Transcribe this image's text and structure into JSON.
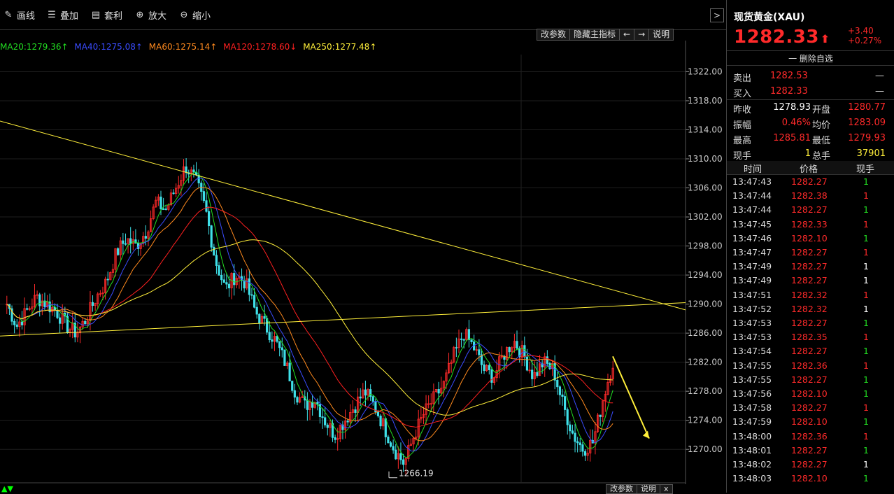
{
  "toolbar": {
    "draw": {
      "label": "画线",
      "icon": "pencil-icon"
    },
    "overlay": {
      "label": "叠加",
      "icon": "layers-icon"
    },
    "arbitrage": {
      "label": "套利",
      "icon": "arbitrage-icon"
    },
    "zoom_in": {
      "label": "放大",
      "icon": "zoom-in-icon"
    },
    "zoom_out": {
      "label": "缩小",
      "icon": "zoom-out-icon"
    },
    "collapse": ">"
  },
  "chart_tools": {
    "params": "改参数",
    "hide": "隐藏主指标",
    "left": "←",
    "right": "→",
    "help": "说明"
  },
  "bottom_tools": {
    "params": "改参数",
    "help": "说明",
    "close": "x"
  },
  "ma_legend": [
    {
      "text": "MA20:1279.36↑",
      "color": "#22dd22"
    },
    {
      "text": "MA40:1275.08↑",
      "color": "#3a4cff"
    },
    {
      "text": "MA60:1275.14↑",
      "color": "#ff8a1e"
    },
    {
      "text": "MA120:1278.60↓",
      "color": "#ff2020"
    },
    {
      "text": "MA250:1277.48↑",
      "color": "#ffef3a"
    }
  ],
  "chart_data": {
    "type": "candlestick",
    "y_ticks": [
      "1322.00",
      "1318.00",
      "1314.00",
      "1310.00",
      "1306.00",
      "1302.00",
      "1298.00",
      "1294.00",
      "1290.00",
      "1286.00",
      "1282.00",
      "1278.00",
      "1274.00",
      "1270.00"
    ],
    "ylim": [
      1266.19,
      1323.5
    ],
    "low_annotation": "1266.19",
    "grid": true,
    "close_path": [
      1290,
      1287,
      1289,
      1291,
      1290,
      1289,
      1287,
      1286,
      1288,
      1291,
      1293,
      1297,
      1299,
      1298,
      1300,
      1304,
      1303,
      1306,
      1309,
      1307,
      1303,
      1296,
      1292,
      1294,
      1293,
      1289,
      1287,
      1285,
      1282,
      1278,
      1276,
      1277,
      1274,
      1272,
      1274,
      1276,
      1278,
      1276,
      1273,
      1270,
      1268,
      1272,
      1275,
      1277,
      1279,
      1283,
      1286,
      1284,
      1281,
      1280,
      1283,
      1285,
      1283,
      1280,
      1282,
      1281,
      1276,
      1272,
      1270,
      1271,
      1277,
      1282
    ]
  },
  "panel": {
    "instrument": "现货黄金(XAU)",
    "price": "1282.33",
    "change": "+3.40",
    "change_pct": "+0.27%",
    "del_fav": "一 删除自选",
    "sell": {
      "label": "卖出",
      "value": "1282.53",
      "extra": "—"
    },
    "buy": {
      "label": "买入",
      "value": "1282.33",
      "extra": "—"
    },
    "stats": [
      {
        "l1": "昨收",
        "v1": "1278.93",
        "c1": "#ffffff",
        "l2": "开盘",
        "v2": "1280.77",
        "c2": "#ff2a2a"
      },
      {
        "l1": "振幅",
        "v1": "0.46%",
        "c1": "#ff2a2a",
        "l2": "均价",
        "v2": "1283.09",
        "c2": "#ff2a2a"
      },
      {
        "l1": "最高",
        "v1": "1285.81",
        "c1": "#ff2a2a",
        "l2": "最低",
        "v2": "1279.93",
        "c2": "#ff2a2a"
      },
      {
        "l1": "现手",
        "v1": "1",
        "c1": "#ffef3a",
        "l2": "总手",
        "v2": "37901",
        "c2": "#ffef3a"
      }
    ],
    "ticks_header": {
      "time": "时间",
      "price": "价格",
      "qty": "现手"
    },
    "ticks": [
      {
        "t": "13:47:43",
        "p": "1282.27",
        "q": "1",
        "c": "#22dd22"
      },
      {
        "t": "13:47:44",
        "p": "1282.38",
        "q": "1",
        "c": "#ff2a2a"
      },
      {
        "t": "13:47:44",
        "p": "1282.27",
        "q": "1",
        "c": "#22dd22"
      },
      {
        "t": "13:47:45",
        "p": "1282.33",
        "q": "1",
        "c": "#ff2a2a"
      },
      {
        "t": "13:47:46",
        "p": "1282.10",
        "q": "1",
        "c": "#22dd22"
      },
      {
        "t": "13:47:47",
        "p": "1282.27",
        "q": "1",
        "c": "#ff2a2a"
      },
      {
        "t": "13:47:49",
        "p": "1282.27",
        "q": "1",
        "c": "#ffffff"
      },
      {
        "t": "13:47:49",
        "p": "1282.27",
        "q": "1",
        "c": "#ffffff"
      },
      {
        "t": "13:47:51",
        "p": "1282.32",
        "q": "1",
        "c": "#ff2a2a"
      },
      {
        "t": "13:47:52",
        "p": "1282.32",
        "q": "1",
        "c": "#ffffff"
      },
      {
        "t": "13:47:53",
        "p": "1282.27",
        "q": "1",
        "c": "#22dd22"
      },
      {
        "t": "13:47:53",
        "p": "1282.35",
        "q": "1",
        "c": "#ff2a2a"
      },
      {
        "t": "13:47:54",
        "p": "1282.27",
        "q": "1",
        "c": "#22dd22"
      },
      {
        "t": "13:47:55",
        "p": "1282.36",
        "q": "1",
        "c": "#ff2a2a"
      },
      {
        "t": "13:47:55",
        "p": "1282.27",
        "q": "1",
        "c": "#22dd22"
      },
      {
        "t": "13:47:56",
        "p": "1282.10",
        "q": "1",
        "c": "#22dd22"
      },
      {
        "t": "13:47:58",
        "p": "1282.27",
        "q": "1",
        "c": "#ff2a2a"
      },
      {
        "t": "13:47:59",
        "p": "1282.10",
        "q": "1",
        "c": "#22dd22"
      },
      {
        "t": "13:48:00",
        "p": "1282.36",
        "q": "1",
        "c": "#ff2a2a"
      },
      {
        "t": "13:48:01",
        "p": "1282.27",
        "q": "1",
        "c": "#22dd22"
      },
      {
        "t": "13:48:02",
        "p": "1282.27",
        "q": "1",
        "c": "#ffffff"
      },
      {
        "t": "13:48:03",
        "p": "1282.10",
        "q": "1",
        "c": "#22dd22"
      }
    ]
  }
}
